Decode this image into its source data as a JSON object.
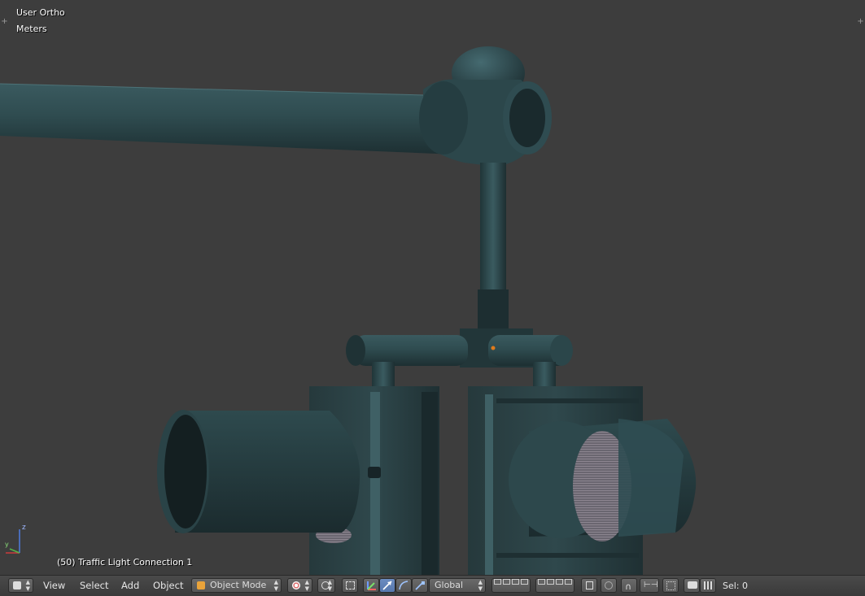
{
  "viewport": {
    "view_name": "User Ortho",
    "units": "Meters",
    "object_info": "(50) Traffic Light Connection 1",
    "axis_labels": {
      "z": "z",
      "y": "y"
    }
  },
  "header": {
    "editor_type_icon": "cube-editor-icon",
    "menus": {
      "view": "View",
      "select": "Select",
      "add": "Add",
      "object": "Object"
    },
    "mode": {
      "label": "Object Mode",
      "icon": "cube-mode-icon"
    },
    "viewport_shading_icon": "shading-sphere-icon",
    "pivot_icon": "pivot-point-icon",
    "manipulator_icons": [
      "manipulator-toggle-icon",
      "translate-icon",
      "rotate-icon",
      "scale-icon"
    ],
    "transform_orientation": "Global",
    "snap_icons": [
      "snap-magnet-icon",
      "snap-element-icon"
    ],
    "render_icons": [
      "render-still-icon",
      "render-anim-icon"
    ],
    "selection_status": "Sel: 0"
  },
  "colors": {
    "background": "#3d3d3d",
    "model_primary": "#2e4b4f",
    "model_dark": "#1c2c2f",
    "header_bg": "#424242",
    "active_button": "#5677ad"
  }
}
